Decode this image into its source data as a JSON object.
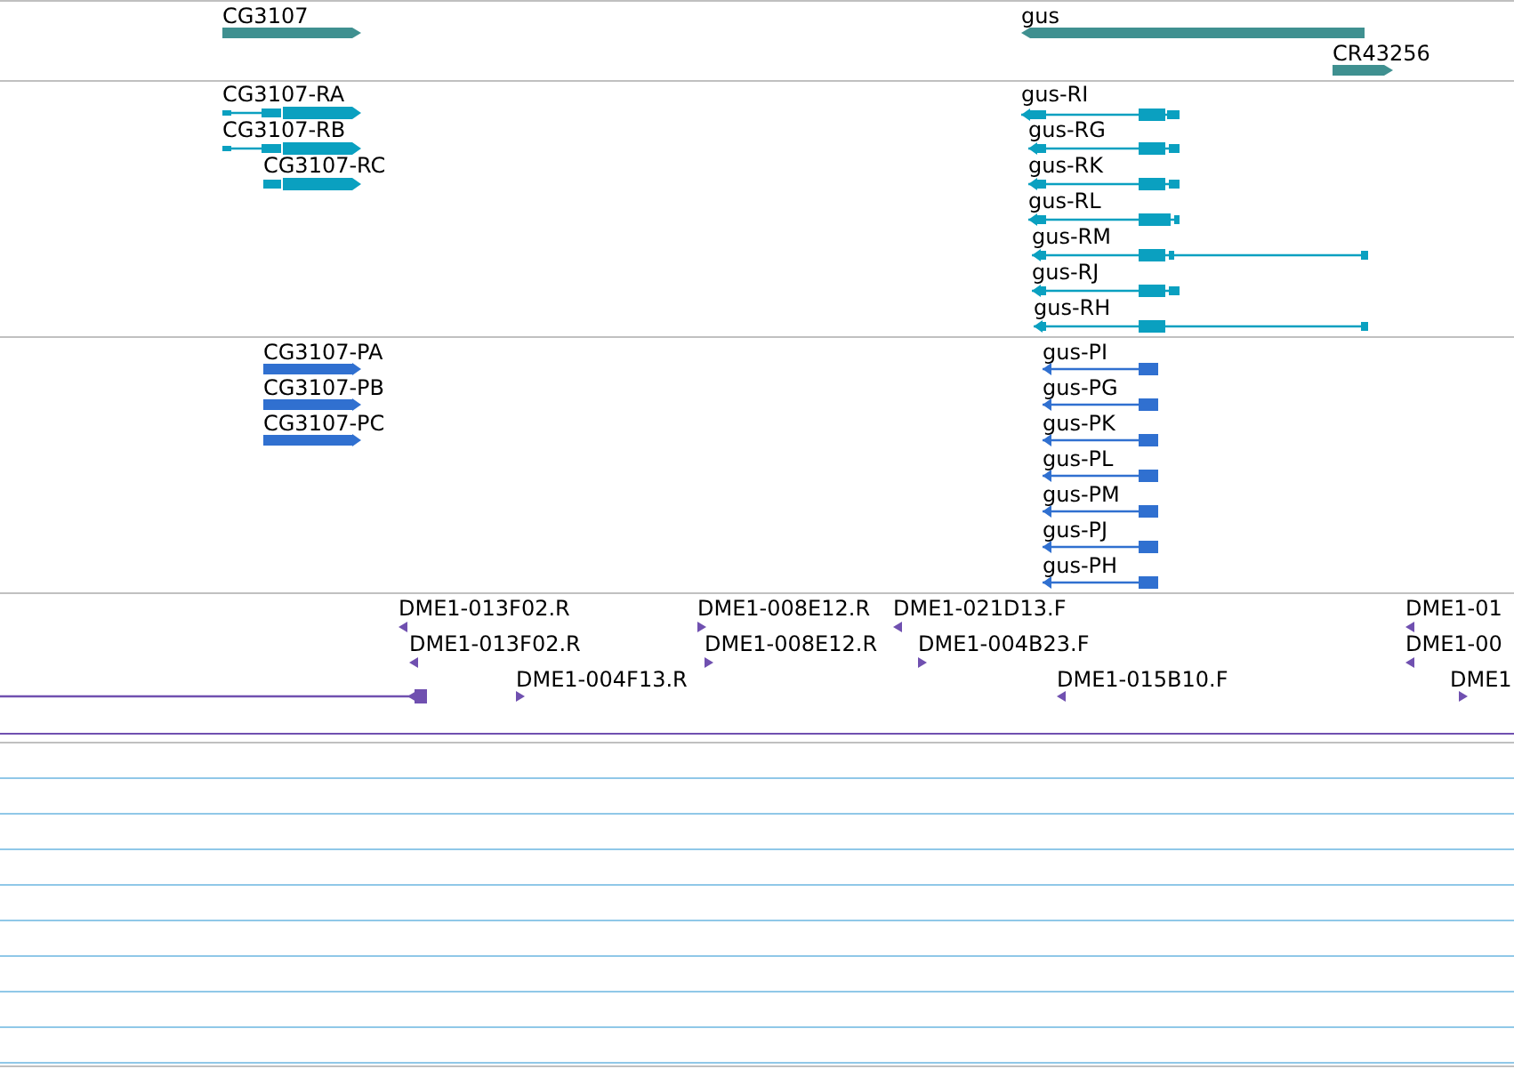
{
  "tracks": [
    {
      "kind": "gene",
      "features": [
        {
          "label": "CG3107",
          "reverse": false
        },
        {
          "label": "gus",
          "reverse": true
        },
        {
          "label": "CR43256",
          "reverse": false
        }
      ]
    },
    {
      "kind": "transcript",
      "features": [
        {
          "label": "CG3107-RA",
          "reverse": false
        },
        {
          "label": "CG3107-RB",
          "reverse": false
        },
        {
          "label": "CG3107-RC",
          "reverse": false
        },
        {
          "label": "gus-RI",
          "reverse": true
        },
        {
          "label": "gus-RG",
          "reverse": true
        },
        {
          "label": "gus-RK",
          "reverse": true
        },
        {
          "label": "gus-RL",
          "reverse": true
        },
        {
          "label": "gus-RM",
          "reverse": true
        },
        {
          "label": "gus-RJ",
          "reverse": true
        },
        {
          "label": "gus-RH",
          "reverse": true
        }
      ]
    },
    {
      "kind": "protein",
      "features": [
        {
          "label": "CG3107-PA",
          "reverse": false
        },
        {
          "label": "CG3107-PB",
          "reverse": false
        },
        {
          "label": "CG3107-PC",
          "reverse": false
        },
        {
          "label": "gus-PI",
          "reverse": true
        },
        {
          "label": "gus-PG",
          "reverse": true
        },
        {
          "label": "gus-PK",
          "reverse": true
        },
        {
          "label": "gus-PL",
          "reverse": true
        },
        {
          "label": "gus-PM",
          "reverse": true
        },
        {
          "label": "gus-PJ",
          "reverse": true
        },
        {
          "label": "gus-PH",
          "reverse": true
        }
      ]
    },
    {
      "kind": "clone",
      "features": [
        {
          "label": "DME1-013F02.R",
          "reverse": true
        },
        {
          "label": "DME1-013F02.R",
          "reverse": true
        },
        {
          "label": "DME1-004F13.R",
          "reverse": false
        },
        {
          "label": "DME1-008E12.R",
          "reverse": false
        },
        {
          "label": "DME1-008E12.R",
          "reverse": false
        },
        {
          "label": "DME1-021D13.F",
          "reverse": true
        },
        {
          "label": "DME1-004B23.F",
          "reverse": false
        },
        {
          "label": "DME1-015B10.F",
          "reverse": true
        },
        {
          "label": "DME1-01",
          "reverse": true
        },
        {
          "label": "DME1-00",
          "reverse": true
        },
        {
          "label": "DME1",
          "reverse": false
        },
        {
          "reverse": true
        }
      ]
    }
  ]
}
